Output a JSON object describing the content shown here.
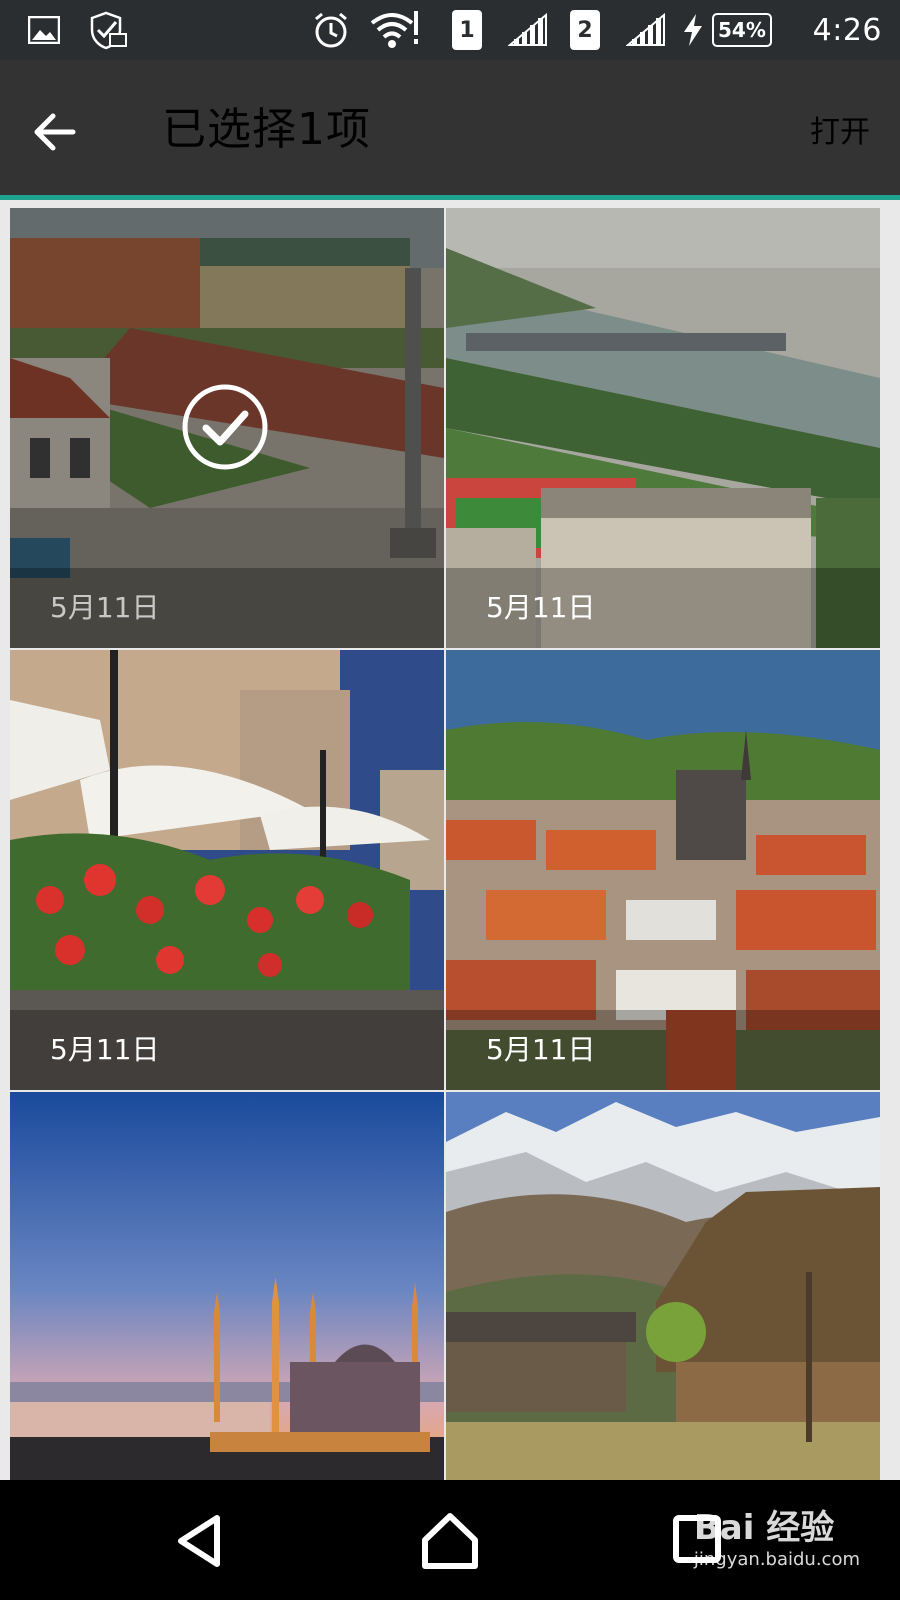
{
  "status_bar": {
    "time": "4:26",
    "battery": "54%",
    "sim1": "1",
    "sim2": "2",
    "icons": [
      "gallery-icon",
      "shield-check-icon",
      "alarm-icon",
      "wifi-icon",
      "signal-icon",
      "charging-icon"
    ]
  },
  "app_bar": {
    "title": "已选择1项",
    "action_label": "打开",
    "back_icon": "arrow-back-icon"
  },
  "grid": {
    "tiles": [
      {
        "date": "5月11日",
        "selected": true,
        "scene": "old-town-square"
      },
      {
        "date": "5月11日",
        "selected": false,
        "scene": "river-city-aerial"
      },
      {
        "date": "5月11日",
        "selected": false,
        "scene": "cafe-umbrellas-flowers"
      },
      {
        "date": "5月11日",
        "selected": false,
        "scene": "red-roof-town"
      },
      {
        "date": "",
        "selected": false,
        "scene": "mosque-dusk"
      },
      {
        "date": "",
        "selected": false,
        "scene": "mountain-village"
      }
    ]
  },
  "watermark": {
    "brand": "Bai 经验",
    "url": "jingyan.baidu.com"
  },
  "nav_bar": {
    "icons": [
      "back-triangle-icon",
      "home-icon",
      "recents-icon"
    ]
  }
}
